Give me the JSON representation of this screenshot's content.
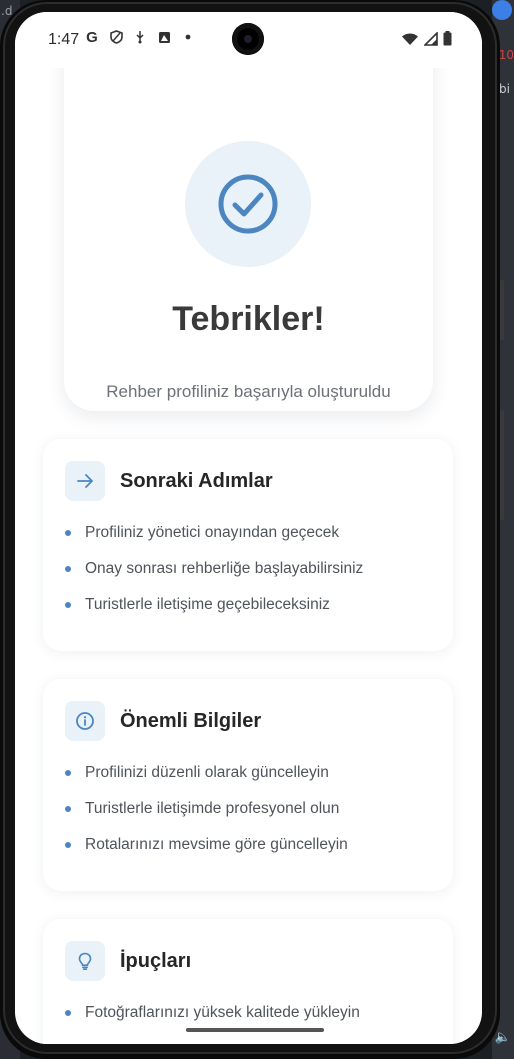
{
  "status_bar": {
    "time": "1:47",
    "left_icons": [
      "google-g-icon",
      "shield-icon",
      "usb-icon",
      "image-icon",
      "dot-icon"
    ],
    "right_icons": [
      "wifi-icon",
      "signal-icon",
      "battery-icon"
    ]
  },
  "desktop": {
    "text_top_left": ".d",
    "text_top_right": "10",
    "text_top_right_2": "bi"
  },
  "hero": {
    "title": "Tebrikler!",
    "subtitle": "Rehber profiliniz başarıyla oluşturuldu"
  },
  "cards": [
    {
      "title": "Sonraki Adımlar",
      "icon": "arrow-right-icon",
      "items": [
        "Profiliniz yönetici onayından geçecek",
        "Onay sonrası rehberliğe başlayabilirsiniz",
        "Turistlerle iletişime geçebileceksiniz"
      ]
    },
    {
      "title": "Önemli Bilgiler",
      "icon": "info-icon",
      "items": [
        "Profilinizi düzenli olarak güncelleyin",
        "Turistlerle iletişimde profesyonel olun",
        "Rotalarınızı mevsime göre güncelleyin"
      ]
    },
    {
      "title": "İpuçları",
      "icon": "lightbulb-icon",
      "items": [
        "Fotoğraflarınızı yüksek kalitede yükleyin"
      ]
    }
  ],
  "colors": {
    "accent": "#4b86c0",
    "icon_bg": "#e9f1f9",
    "title": "#3a3a3a",
    "text": "#4f545b"
  }
}
